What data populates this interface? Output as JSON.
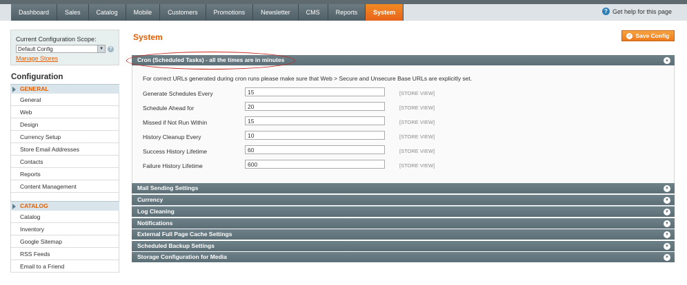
{
  "nav": {
    "items": [
      "Dashboard",
      "Sales",
      "Catalog",
      "Mobile",
      "Customers",
      "Promotions",
      "Newsletter",
      "CMS",
      "Reports",
      "System"
    ],
    "active": "System",
    "help_label": "Get help for this page"
  },
  "sidebar": {
    "scope_label": "Current Configuration Scope:",
    "scope_value": "Default Config",
    "manage_stores": "Manage Stores",
    "config_title": "Configuration",
    "groups": [
      {
        "title": "GENERAL",
        "items": [
          "General",
          "Web",
          "Design",
          "Currency Setup",
          "Store Email Addresses",
          "Contacts",
          "Reports",
          "Content Management"
        ]
      },
      {
        "title": "CATALOG",
        "items": [
          "Catalog",
          "Inventory",
          "Google Sitemap",
          "RSS Feeds",
          "Email to a Friend"
        ]
      }
    ]
  },
  "main": {
    "title": "System",
    "save_label": "Save Config",
    "cron": {
      "title": "Cron (Scheduled Tasks) - all the times are in minutes",
      "note": "For correct URLs generated during cron runs please make sure that Web > Secure and Unsecure Base URLs are explicitly set.",
      "rows": [
        {
          "label": "Generate Schedules Every",
          "value": "15",
          "scope": "[STORE VIEW]"
        },
        {
          "label": "Schedule Ahead for",
          "value": "20",
          "scope": "[STORE VIEW]"
        },
        {
          "label": "Missed if Not Run Within",
          "value": "15",
          "scope": "[STORE VIEW]"
        },
        {
          "label": "History Cleanup Every",
          "value": "10",
          "scope": "[STORE VIEW]"
        },
        {
          "label": "Success History Lifetime",
          "value": "60",
          "scope": "[STORE VIEW]"
        },
        {
          "label": "Failure History Lifetime",
          "value": "600",
          "scope": "[STORE VIEW]"
        }
      ]
    },
    "sections": [
      "Mail Sending Settings",
      "Currency",
      "Log Cleaning",
      "Notifications",
      "External Full Page Cache Settings",
      "Scheduled Backup Settings",
      "Storage Configuration for Media"
    ]
  },
  "colors": {
    "accent": "#e35e00",
    "header_bar": "#5c6e76",
    "nav_active": "#e8641b"
  }
}
